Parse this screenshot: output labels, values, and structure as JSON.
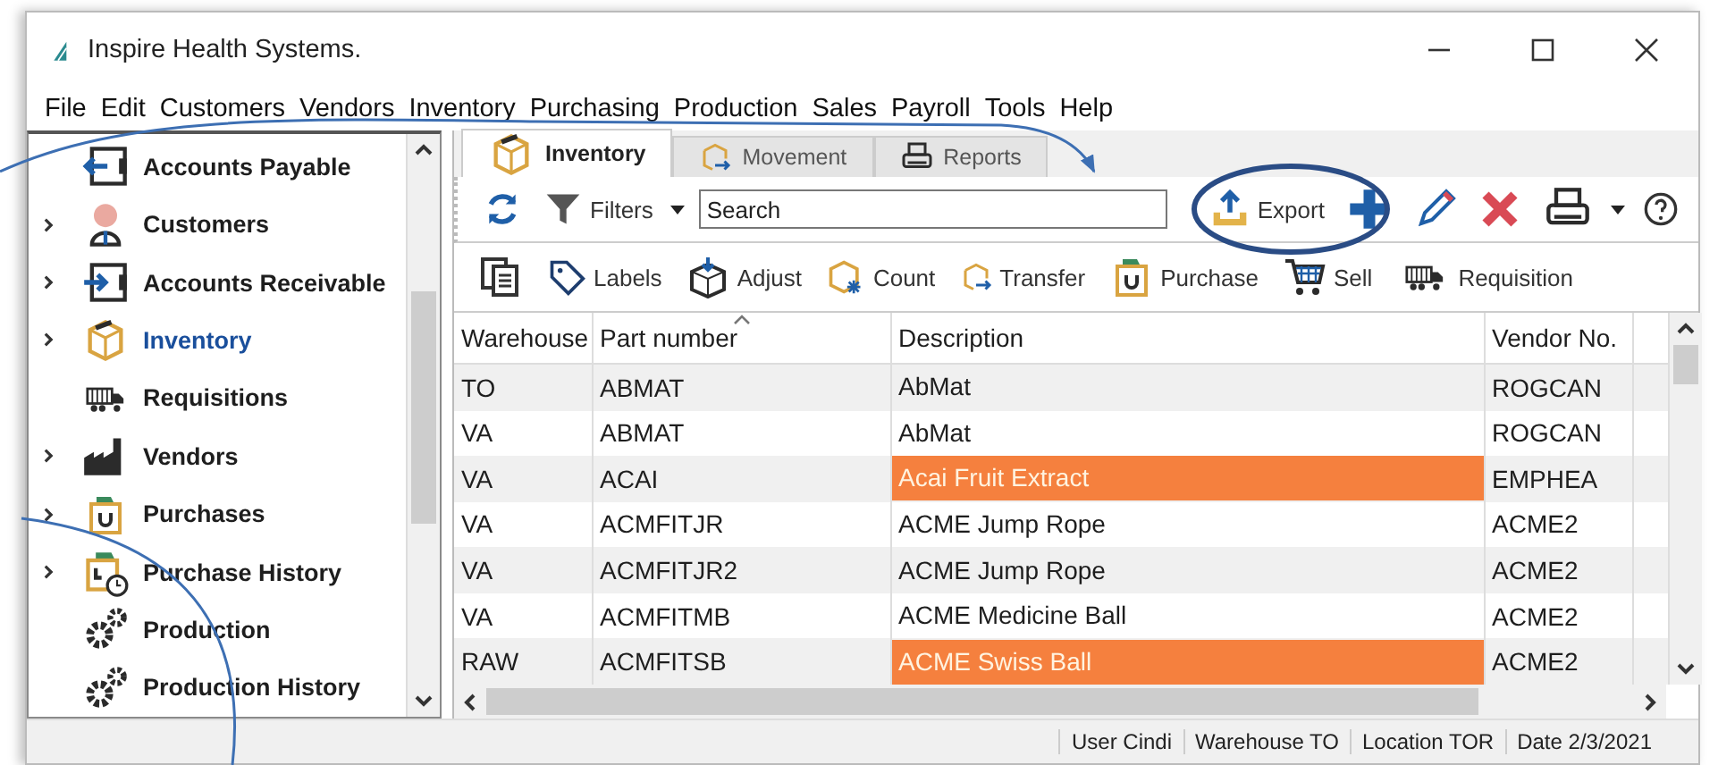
{
  "window": {
    "title": "Inspire Health Systems."
  },
  "menu": [
    "File",
    "Edit",
    "Customers",
    "Vendors",
    "Inventory",
    "Purchasing",
    "Production",
    "Sales",
    "Payroll",
    "Tools",
    "Help"
  ],
  "sidebar": {
    "items": [
      {
        "label": "Accounts Payable",
        "kind": "payable",
        "expandable": false,
        "selected": false
      },
      {
        "label": "Customers",
        "kind": "customers",
        "expandable": true,
        "selected": false
      },
      {
        "label": "Accounts Receivable",
        "kind": "receivable",
        "expandable": true,
        "selected": false
      },
      {
        "label": "Inventory",
        "kind": "inventory",
        "expandable": true,
        "selected": true
      },
      {
        "label": "Requisitions",
        "kind": "truck",
        "expandable": false,
        "selected": false
      },
      {
        "label": "Vendors",
        "kind": "factory",
        "expandable": true,
        "selected": false
      },
      {
        "label": "Purchases",
        "kind": "bag",
        "expandable": true,
        "selected": false
      },
      {
        "label": "Purchase History",
        "kind": "bag-clock",
        "expandable": true,
        "selected": false
      },
      {
        "label": "Production",
        "kind": "gears",
        "expandable": false,
        "selected": false
      },
      {
        "label": "Production History",
        "kind": "gears",
        "expandable": false,
        "selected": false
      }
    ]
  },
  "tabs": [
    {
      "label": "Inventory",
      "kind": "inventory",
      "selected": true
    },
    {
      "label": "Movement",
      "kind": "movement",
      "selected": false
    },
    {
      "label": "Reports",
      "kind": "printer",
      "selected": false
    }
  ],
  "toolbar": {
    "filters": "Filters",
    "search": {
      "placeholder": "Search"
    },
    "export": "Export"
  },
  "actions": [
    {
      "label": "Labels",
      "kind": "tag"
    },
    {
      "label": "Adjust",
      "kind": "adjust"
    },
    {
      "label": "Count",
      "kind": "count"
    },
    {
      "label": "Transfer",
      "kind": "movement"
    },
    {
      "label": "Purchase",
      "kind": "bag"
    },
    {
      "label": "Sell",
      "kind": "cart"
    },
    {
      "label": "Requisition",
      "kind": "truck"
    }
  ],
  "table": {
    "columns": [
      {
        "label": "Warehouse",
        "sorted": false
      },
      {
        "label": "Part number",
        "sorted": true
      },
      {
        "label": "Description",
        "sorted": false
      },
      {
        "label": "Vendor No.",
        "sorted": false
      }
    ],
    "rows": [
      {
        "cells": [
          "TO",
          "ABMAT",
          "AbMat",
          "ROGCAN"
        ],
        "flagged": false
      },
      {
        "cells": [
          "VA",
          "ABMAT",
          "AbMat",
          "ROGCAN"
        ],
        "flagged": false
      },
      {
        "cells": [
          "VA",
          "ACAI",
          "Acai Fruit Extract",
          "EMPHEA"
        ],
        "flagged": true
      },
      {
        "cells": [
          "VA",
          "ACMFITJR",
          "ACME Jump Rope",
          "ACME2"
        ],
        "flagged": false
      },
      {
        "cells": [
          "VA",
          "ACMFITJR2",
          "ACME Jump Rope",
          "ACME2"
        ],
        "flagged": false
      },
      {
        "cells": [
          "VA",
          "ACMFITMB",
          "ACME Medicine Ball",
          "ACME2"
        ],
        "flagged": false
      },
      {
        "cells": [
          "RAW",
          "ACMFITSB",
          "ACME Swiss Ball",
          "ACME2"
        ],
        "flagged": true
      }
    ]
  },
  "status_bar": [
    "User Cindi",
    "Warehouse TO",
    "Location TOR",
    "Date 2/3/2021"
  ]
}
